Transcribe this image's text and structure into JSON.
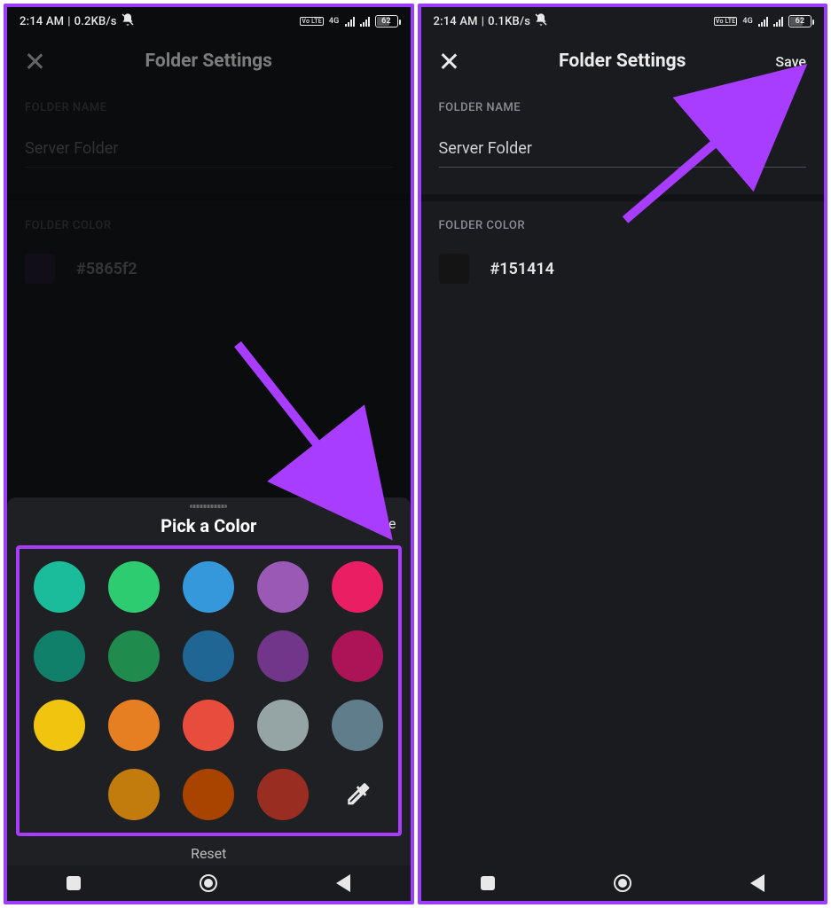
{
  "statusbar": {
    "left_time": "2:14 AM",
    "left_speed1": "0.2KB/s",
    "left_speed2": "0.1KB/s",
    "fourg": "4G",
    "volte": "Vo LTE",
    "battery_pct": "62"
  },
  "header": {
    "title": "Folder Settings",
    "save": "Save"
  },
  "folder_name": {
    "label": "FOLDER NAME",
    "value": "Server Folder"
  },
  "folder_color": {
    "label": "FOLDER COLOR",
    "hex_left": "#5865f2",
    "swatch_left": "#352a5a",
    "hex_right": "#151414",
    "swatch_right": "#151414"
  },
  "sheet": {
    "title": "Pick a Color",
    "save": "Save",
    "reset": "Reset",
    "colors_row1": [
      "#1abc9c",
      "#2ecc71",
      "#3498db",
      "#9b59b6",
      "#e91e63"
    ],
    "colors_row2": [
      "#11806a",
      "#1f8b4c",
      "#206694",
      "#71368a",
      "#ad1457"
    ],
    "colors_row3": [
      "#f1c40f",
      "#e67e22",
      "#e74c3c",
      "#95a5a6",
      "#607d8b"
    ],
    "colors_row4": [
      "#c27c0e",
      "#a84300",
      "#992d22"
    ]
  }
}
